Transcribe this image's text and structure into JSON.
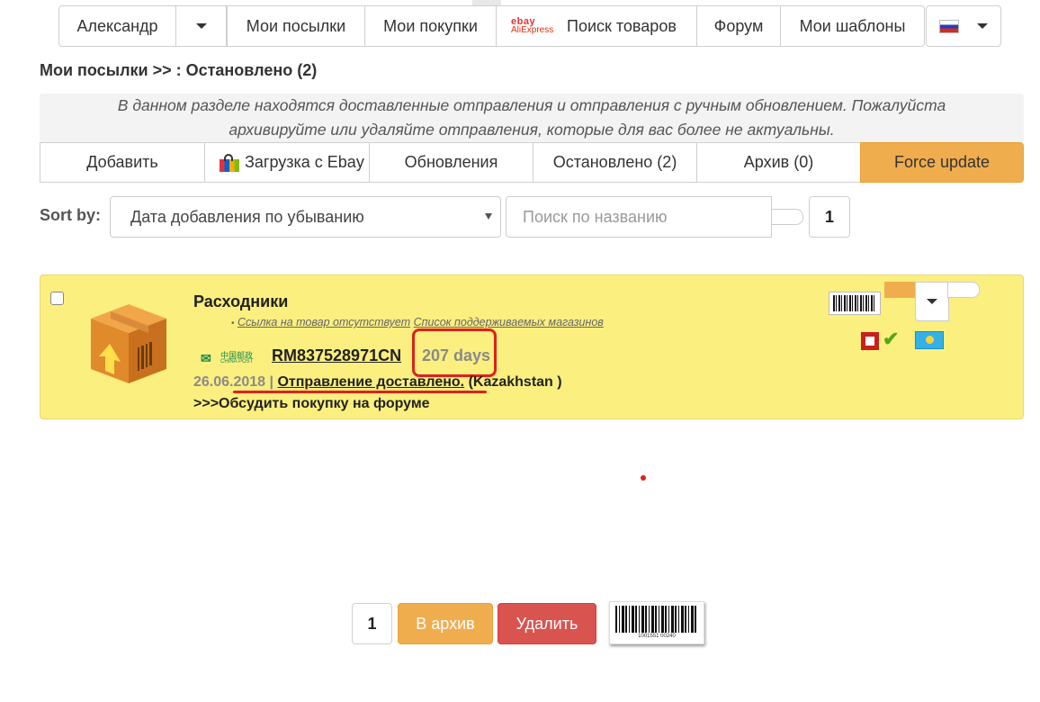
{
  "topnav": {
    "user": "Александр",
    "items": [
      "Мои посылки",
      "Мои покупки",
      "Поиск товаров",
      "Форум",
      "Мои шаблоны"
    ],
    "logo_top": "ebay",
    "logo_bottom": "AliExpress"
  },
  "breadcrumb": "Мои посылки >> : Остановлено (2)",
  "info_line1": "В данном разделе находятся доставленные отправления и отправления с ручным обновлением. Пожалуйста",
  "info_line2": "архивируйте или удаляйте отправления, которые для вас более не актуальны.",
  "tabs": [
    "Добавить",
    "Загрузка с Ebay",
    "Обновления",
    "Остановлено (2)",
    "Архив (0)",
    "Force update"
  ],
  "sort": {
    "label": "Sort by:",
    "value": "Дата добавления по убыванию"
  },
  "search": {
    "placeholder": "Поиск по названию"
  },
  "page_top": "1",
  "parcel": {
    "title": "Расходники",
    "link_missing": "Ссылка на товар отсутствует",
    "supported_shops": "Список поддерживаемых магазинов",
    "carrier_cn": "中国邮政",
    "carrier_en": "CHINA POST",
    "tracking": "RM837528971CN",
    "days": "207 days",
    "date": "26.06.2018",
    "sep": "|",
    "status": "Отправление доставлено.",
    "country": "(Kazakhstan )",
    "forum": ">>>Обсудить покупку на форуме"
  },
  "bottom": {
    "page": "1",
    "archive": "В архив",
    "delete": "Удалить"
  },
  "barcode_number": "1001551 00240",
  "colors": {
    "card": "#fbef7f",
    "orange": "#f0ad4e",
    "red": "#d9534f",
    "annotation": "#e0201c"
  }
}
